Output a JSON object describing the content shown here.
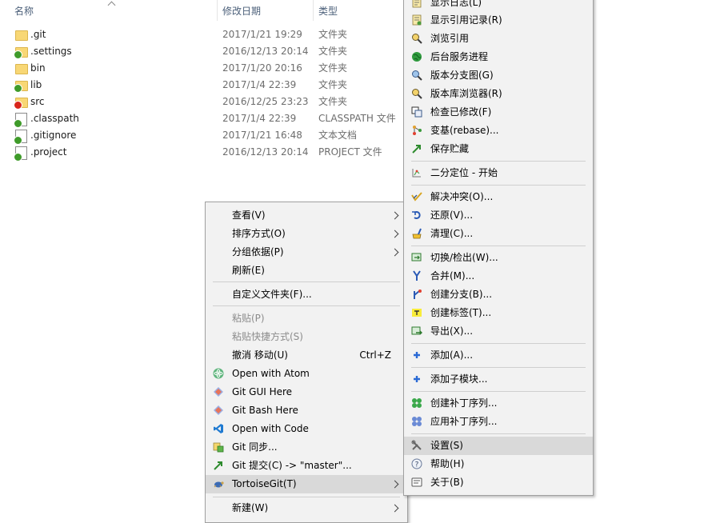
{
  "columns": {
    "name": "名称",
    "date": "修改日期",
    "type": "类型"
  },
  "files": [
    {
      "name": ".git",
      "date": "2017/1/21 19:29",
      "type": "文件夹",
      "icon": "folder-icon",
      "overlay": ""
    },
    {
      "name": ".settings",
      "date": "2016/12/13 20:14",
      "type": "文件夹",
      "icon": "folder-icon",
      "overlay": "green"
    },
    {
      "name": "bin",
      "date": "2017/1/20 20:16",
      "type": "文件夹",
      "icon": "folder-icon",
      "overlay": ""
    },
    {
      "name": "lib",
      "date": "2017/1/4 22:39",
      "type": "文件夹",
      "icon": "folder-icon",
      "overlay": "green"
    },
    {
      "name": "src",
      "date": "2016/12/25 23:23",
      "type": "文件夹",
      "icon": "folder-icon",
      "overlay": "red"
    },
    {
      "name": ".classpath",
      "date": "2017/1/4 22:39",
      "type": "CLASSPATH 文件",
      "icon": "file-icon",
      "overlay": "green"
    },
    {
      "name": ".gitignore",
      "date": "2017/1/21 16:48",
      "type": "文本文档",
      "icon": "file-icon",
      "overlay": "green"
    },
    {
      "name": ".project",
      "date": "2016/12/13 20:14",
      "type": "PROJECT 文件",
      "icon": "file-icon",
      "overlay": "green"
    }
  ],
  "context_menu": {
    "view": "查看(V)",
    "sort": "排序方式(O)",
    "group": "分组依据(P)",
    "refresh": "刷新(E)",
    "customize": "自定义文件夹(F)...",
    "paste": "粘贴(P)",
    "paste_shortcut": "粘贴快捷方式(S)",
    "undo_move": "撤消 移动(U)",
    "undo_shortcut": "Ctrl+Z",
    "open_atom": "Open with Atom",
    "git_gui": "Git GUI Here",
    "git_bash": "Git Bash Here",
    "open_code": "Open with Code",
    "git_sync": "Git 同步...",
    "git_commit": "Git 提交(C) -> \"master\"...",
    "tortoisegit": "TortoiseGit(T)",
    "new": "新建(W)"
  },
  "tortoise_menu": {
    "show_log": "显示日志(L)",
    "show_reflog": "显示引用记录(R)",
    "browse_refs": "浏览引用",
    "daemon": "后台服务进程",
    "revision_graph": "版本分支图(G)",
    "repo_browser": "版本库浏览器(R)",
    "check_modified": "检查已修改(F)",
    "rebase": "变基(rebase)...",
    "stash_save": "保存贮藏",
    "bisect_start": "二分定位 - 开始",
    "resolve": "解决冲突(O)...",
    "revert": "还原(V)...",
    "cleanup": "清理(C)...",
    "switch_checkout": "切换/检出(W)...",
    "merge": "合并(M)...",
    "create_branch": "创建分支(B)...",
    "create_tag": "创建标签(T)...",
    "export": "导出(X)...",
    "add": "添加(A)...",
    "add_submodule": "添加子模块...",
    "create_patch": "创建补丁序列...",
    "apply_patch": "应用补丁序列...",
    "settings": "设置(S)",
    "help": "帮助(H)",
    "about": "关于(B)"
  },
  "colors": {
    "menu_bg": "#f2f2f2",
    "highlight": "#d9d9d9",
    "disabled_text": "#8c8c8c",
    "header_text": "#4c607a"
  }
}
